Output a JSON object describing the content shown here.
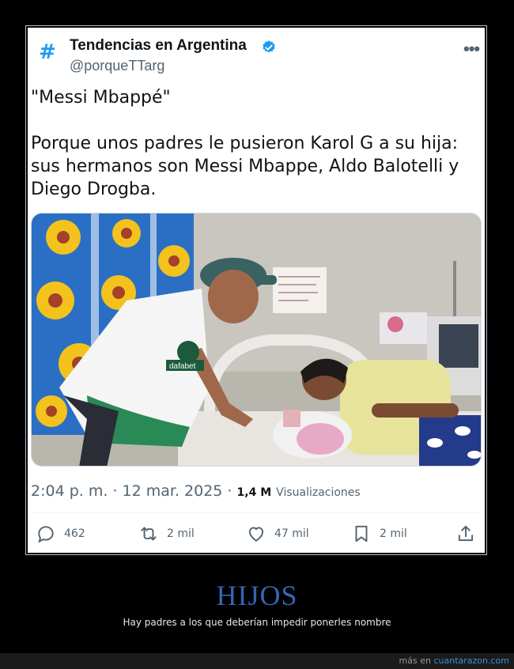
{
  "tweet": {
    "account_name": "Tendencias en Argentina",
    "handle": "@porqueTTarg",
    "quote_line": "\"Messi Mbappé\"",
    "body_text": "Porque unos padres le pusieron Karol G a su hija: sus hermanos son Messi Mbappe, Aldo Balotelli y Diego Drogba.",
    "timestamp": "2:04 p. m. · 12 mar. 2025 ·",
    "views_count": "1,4 M",
    "views_label": "Visualizaciones",
    "replies": "462",
    "retweets": "2 mil",
    "likes": "47 mil",
    "bookmarks": "2 mil",
    "photo_shirt_text": "dafabet"
  },
  "post": {
    "title": "HIJOS",
    "subtitle": "Hay padres a los que deberían impedir ponerles nombre"
  },
  "footer": {
    "prefix": "más en",
    "site": "cuantarazon.com"
  },
  "colors": {
    "accent": "#1d9bf0",
    "title": "#3565b5",
    "link": "#3f8fd8"
  }
}
